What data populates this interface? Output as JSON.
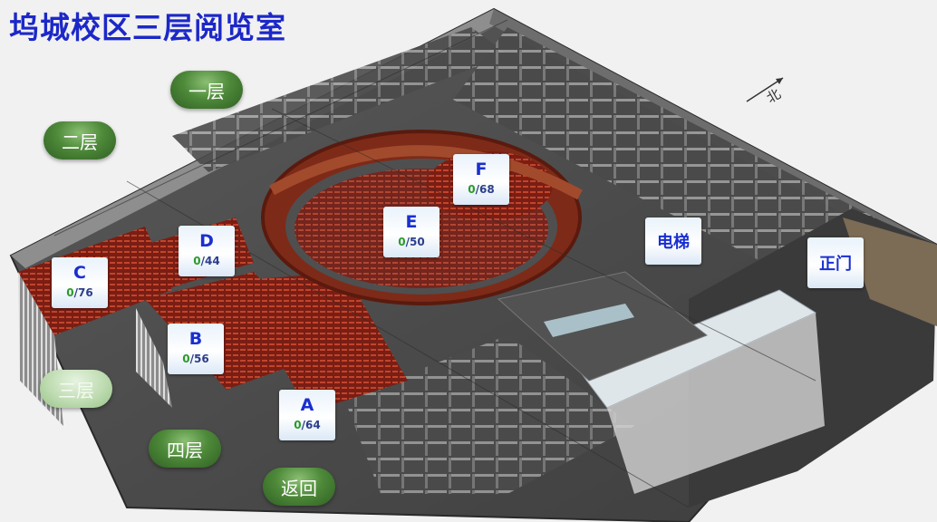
{
  "title": "坞城校区三层阅览室",
  "floors": [
    {
      "label": "一层",
      "active": false
    },
    {
      "label": "二层",
      "active": false
    },
    {
      "label": "三层",
      "active": true
    },
    {
      "label": "四层",
      "active": false
    }
  ],
  "back_label": "返回",
  "zones": [
    {
      "id": "A",
      "used": "0",
      "total": "64"
    },
    {
      "id": "B",
      "used": "0",
      "total": "56"
    },
    {
      "id": "C",
      "used": "0",
      "total": "76"
    },
    {
      "id": "D",
      "used": "0",
      "total": "44"
    },
    {
      "id": "E",
      "used": "0",
      "total": "50"
    },
    {
      "id": "F",
      "used": "0",
      "total": "68"
    }
  ],
  "landmarks": {
    "elevator": "电梯",
    "main_gate": "正门"
  },
  "compass": {
    "north_label": "北"
  },
  "colors": {
    "title": "#1c28c8",
    "button_green": "#4e8a3a",
    "zone_label": "#1a2fd0",
    "used_count": "#2b9a2b"
  }
}
